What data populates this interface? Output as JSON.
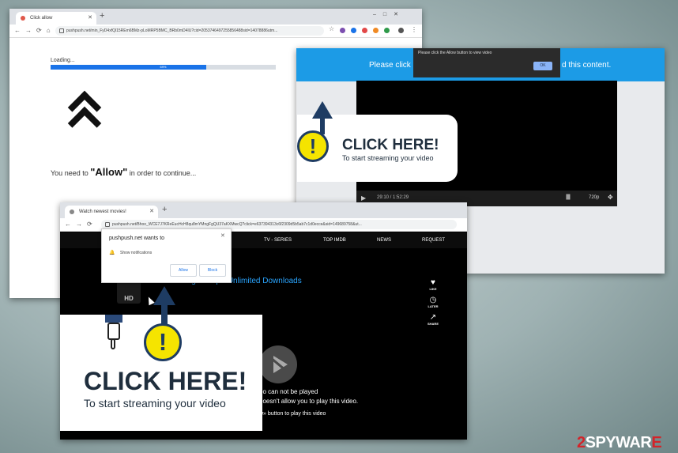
{
  "win1": {
    "tab_title": "Click allow",
    "url": "pushpush.net/min_FyD4xfQl15REm6BMz-pLoMRP5BMC_BRb0mD4IU?cid=2053746497255856488sid=14078886utm...",
    "loading_label": "Loading...",
    "progress_percent": 69,
    "progress_text": "69%",
    "prompt_pre": "You need to",
    "prompt_allow": "\"Allow\"",
    "prompt_post": "in order to continue..."
  },
  "win2": {
    "banner_pre": "Please click c",
    "banner_post": "d this content.",
    "tooltip_text": "Please click the Allow button to view video",
    "tooltip_ok": "OK",
    "time": "29:10 / 1:52:29",
    "quality": "720p",
    "volume": "||||||",
    "cta_title": "CLICK HERE!",
    "cta_sub": "To start streaming your video"
  },
  "win3": {
    "tab_title": "Watch newest movies!",
    "url": "pushpush.net/Bhoo_WCE7J7KReEucHcH8qu8mYMngFgQU37aKXMwcQ?click=e637394313c6f2309d5b5ab7c1d0ecce&sid=149689758&ut...",
    "menu": [
      "TV - SERIES",
      "TOP IMDB",
      "NEWS",
      "REQUEST"
    ],
    "popup_title": "pushpush.net wants to",
    "popup_item": "Show notifications",
    "popup_allow": "Allow",
    "popup_block": "Block",
    "streaming_text": "HD Streaming - 720p - Unlimited Downloads",
    "hd_label": "HD",
    "side_icons": [
      {
        "glyph": "♥",
        "label": "LIKE"
      },
      {
        "glyph": "◷",
        "label": "LATER"
      },
      {
        "glyph": "↗",
        "label": "SHARE"
      }
    ],
    "error_line1": "eo can not be played",
    "error_line2": "doesn't allow you to play this video.",
    "error_line3": "w» button to play this video",
    "cta_title": "CLICK HERE!",
    "cta_sub": "To start streaming your video"
  },
  "watermark": {
    "part1": "2",
    "part2": "SPYWAR",
    "part3": "E"
  },
  "colors": {
    "blue_bar": "#1c9be6",
    "progress": "#1a73e8",
    "dark_navy": "#1f2e3d",
    "yellow": "#f5e400",
    "arrow_blue": "#1e3c63",
    "watermark_red": "#d3242a"
  }
}
